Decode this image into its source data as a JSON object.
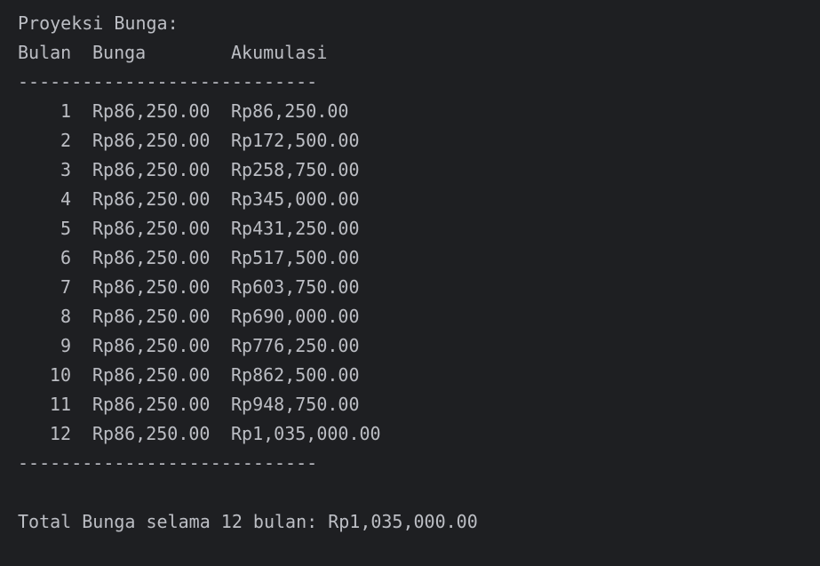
{
  "title": "Proyeksi Bunga:",
  "headers": {
    "month": "Bulan",
    "interest": "Bunga",
    "accumulation": "Akumulasi"
  },
  "separator": "----------------------------",
  "rows": [
    {
      "month": "1",
      "interest": "Rp86,250.00",
      "accumulation": "Rp86,250.00"
    },
    {
      "month": "2",
      "interest": "Rp86,250.00",
      "accumulation": "Rp172,500.00"
    },
    {
      "month": "3",
      "interest": "Rp86,250.00",
      "accumulation": "Rp258,750.00"
    },
    {
      "month": "4",
      "interest": "Rp86,250.00",
      "accumulation": "Rp345,000.00"
    },
    {
      "month": "5",
      "interest": "Rp86,250.00",
      "accumulation": "Rp431,250.00"
    },
    {
      "month": "6",
      "interest": "Rp86,250.00",
      "accumulation": "Rp517,500.00"
    },
    {
      "month": "7",
      "interest": "Rp86,250.00",
      "accumulation": "Rp603,750.00"
    },
    {
      "month": "8",
      "interest": "Rp86,250.00",
      "accumulation": "Rp690,000.00"
    },
    {
      "month": "9",
      "interest": "Rp86,250.00",
      "accumulation": "Rp776,250.00"
    },
    {
      "month": "10",
      "interest": "Rp86,250.00",
      "accumulation": "Rp862,500.00"
    },
    {
      "month": "11",
      "interest": "Rp86,250.00",
      "accumulation": "Rp948,750.00"
    },
    {
      "month": "12",
      "interest": "Rp86,250.00",
      "accumulation": "Rp1,035,000.00"
    }
  ],
  "total_line": "Total Bunga selama 12 bulan: Rp1,035,000.00",
  "colors": {
    "background": "#1e1f22",
    "text": "#bcbec4"
  }
}
